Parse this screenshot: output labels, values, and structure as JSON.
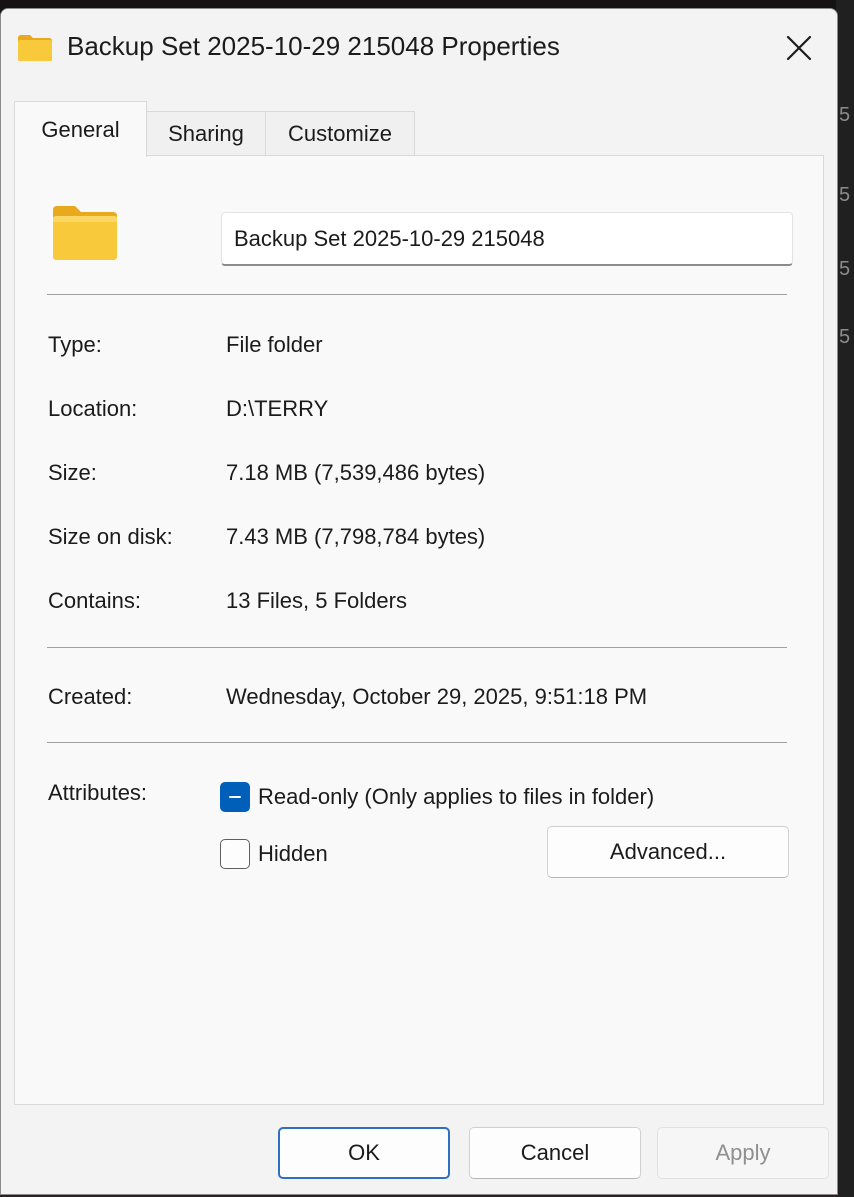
{
  "window": {
    "title": "Backup Set 2025-10-29 215048 Properties"
  },
  "tabs": [
    {
      "label": "General",
      "active": true
    },
    {
      "label": "Sharing",
      "active": false
    },
    {
      "label": "Customize",
      "active": false
    }
  ],
  "general": {
    "folder_name": "Backup Set 2025-10-29 215048",
    "properties": [
      {
        "label": "Type:",
        "value": "File folder"
      },
      {
        "label": "Location:",
        "value": "D:\\TERRY"
      },
      {
        "label": "Size:",
        "value": "7.18 MB (7,539,486 bytes)"
      },
      {
        "label": "Size on disk:",
        "value": "7.43 MB (7,798,784 bytes)"
      },
      {
        "label": "Contains:",
        "value": "13 Files, 5 Folders"
      }
    ],
    "created": {
      "label": "Created:",
      "value": "Wednesday, October 29, 2025, 9:51:18 PM"
    },
    "attributes": {
      "label": "Attributes:",
      "read_only": {
        "label": "Read-only (Only applies to files in folder)",
        "state": "indeterminate"
      },
      "hidden": {
        "label": "Hidden",
        "state": "unchecked"
      },
      "advanced_label": "Advanced..."
    }
  },
  "buttons": {
    "ok": "OK",
    "cancel": "Cancel",
    "apply": "Apply"
  },
  "colors": {
    "accent": "#005fb8",
    "folder": "#f9c93c"
  },
  "icons": {
    "title": "folder-icon",
    "close": "close-icon",
    "large": "folder-icon"
  }
}
